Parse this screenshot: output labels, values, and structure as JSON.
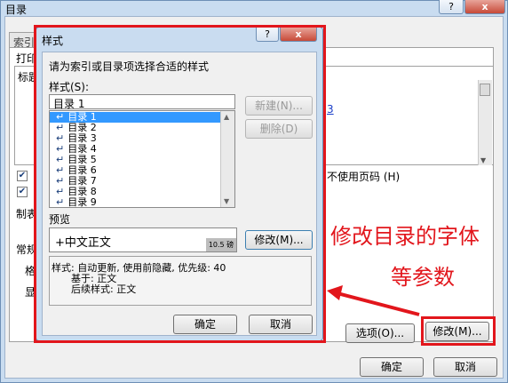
{
  "outer": {
    "title": "目录",
    "help_label": "?",
    "close_label": "x",
    "tab_label": "索引",
    "print_preview_label": "打印",
    "preview_heading": "标题",
    "link_fragment": "3",
    "hyperlink_option": "不使用页码",
    "hyperlink_accel": "(H)",
    "tab_leader_label": "制表",
    "general_label": "常规",
    "format_label": "格",
    "levels_label": "显",
    "options_button": "选项(O)...",
    "modify_button": "修改(M)...",
    "ok_button": "确定",
    "cancel_button": "取消"
  },
  "inner": {
    "title": "样式",
    "help_label": "?",
    "close_label": "x",
    "instruction": "请为索引或目录项选择合适的样式",
    "styles_label": "样式(S):",
    "current_style": "目录 1",
    "new_button": "新建(N)...",
    "delete_button": "删除(D)",
    "styles_list": [
      "目录 1",
      "目录 2",
      "目录 3",
      "目录 4",
      "目录 5",
      "目录 6",
      "目录 7",
      "目录 8",
      "目录 9"
    ],
    "selected_index": 0,
    "preview_label": "预览",
    "preview_text": "+中文正文",
    "preview_size": "10.5 磅",
    "modify_button": "修改(M)...",
    "description_line1": "样式: 自动更新, 使用前隐藏, 优先级: 40",
    "description_line2": "基于: 正文",
    "description_line3": "后续样式: 正文",
    "ok_button": "确定",
    "cancel_button": "取消"
  },
  "annotation": {
    "line1": "修改目录的字体",
    "line2": "等参数",
    "color": "#e2161c"
  },
  "checkbox_states": {
    "outer_checkbox_1": true,
    "outer_checkbox_2": true
  }
}
